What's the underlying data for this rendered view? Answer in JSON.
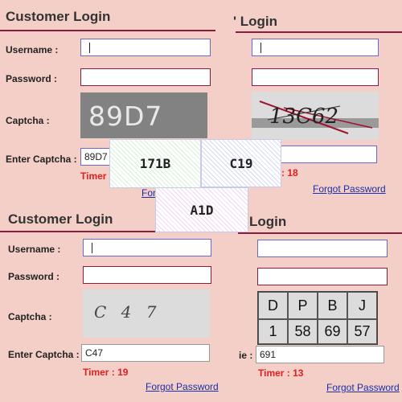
{
  "panels": {
    "top_left": {
      "title": "Customer Login",
      "username_label": "Username :",
      "password_label": "Password :",
      "captcha_label": "Captcha :",
      "enter_captcha_label": "Enter Captcha :",
      "captcha_text": "89D7",
      "captcha_value": "89D7",
      "timer": "Timer",
      "forgot": "Forgot Password"
    },
    "top_right": {
      "title_fragment": "' Login",
      "captcha_text": "13C62",
      "timer_fragment": ": 18",
      "forgot": "Forgot Password"
    },
    "bottom_left": {
      "title": "Customer Login",
      "username_label": "Username :",
      "password_label": "Password :",
      "captcha_label": "Captcha :",
      "enter_captcha_label": "Enter Captcha :",
      "captcha_text": "C 4 7",
      "captcha_value": "C47",
      "timer": "Timer : 19",
      "forgot": "Forgot Password"
    },
    "bottom_right": {
      "title_fragment": "Login",
      "captcha_grid": {
        "headers": [
          "D",
          "P",
          "B",
          "J"
        ],
        "values": [
          "1",
          "58",
          "69",
          "57"
        ]
      },
      "enter_fragment": "ie :",
      "captcha_value": "691",
      "timer": "Timer : 13",
      "forgot": "Forgot Password"
    }
  },
  "overlay_tiles": {
    "tile1": "171B",
    "tile2": "C19",
    "tile3": "A1D"
  }
}
